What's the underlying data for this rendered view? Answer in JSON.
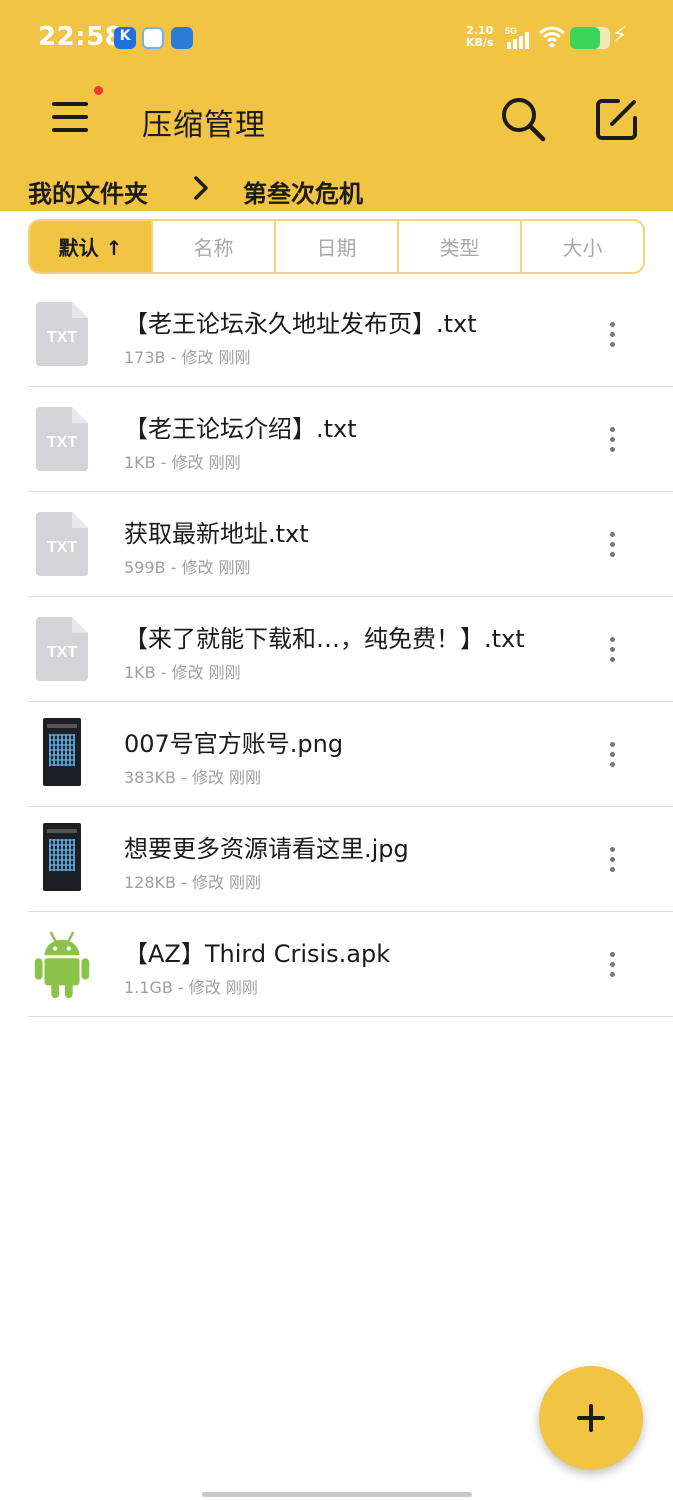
{
  "status_bar": {
    "time": "22:58",
    "net_speed_value": "2.10",
    "net_speed_unit": "KB/s",
    "network": "5G",
    "battery_level": 0.75
  },
  "app_bar": {
    "title": "压缩管理",
    "menu_icon": "menu-icon",
    "search_icon": "search-icon",
    "edit_icon": "edit-icon"
  },
  "breadcrumb": {
    "parent": "我的文件夹",
    "current": "第叁次危机"
  },
  "sort_tabs": [
    {
      "label": "默认 ↑",
      "active": true
    },
    {
      "label": "名称",
      "active": false
    },
    {
      "label": "日期",
      "active": false
    },
    {
      "label": "类型",
      "active": false
    },
    {
      "label": "大小",
      "active": false
    }
  ],
  "files": [
    {
      "name": "【老王论坛永久地址发布页】.txt",
      "meta": "173B - 修改 刚刚",
      "icon": "txt-file-icon",
      "icon_label": "TXT"
    },
    {
      "name": "【老王论坛介绍】.txt",
      "meta": "1KB - 修改 刚刚",
      "icon": "txt-file-icon",
      "icon_label": "TXT"
    },
    {
      "name": "获取最新地址.txt",
      "meta": "599B - 修改 刚刚",
      "icon": "txt-file-icon",
      "icon_label": "TXT"
    },
    {
      "name": "【来了就能下载和…，纯免费！】.txt",
      "meta": "1KB - 修改 刚刚",
      "icon": "txt-file-icon",
      "icon_label": "TXT"
    },
    {
      "name": "007号官方账号.png",
      "meta": "383KB - 修改 刚刚",
      "icon": "image-thumbnail-icon"
    },
    {
      "name": "想要更多资源请看这里.jpg",
      "meta": "128KB - 修改 刚刚",
      "icon": "image-thumbnail-icon"
    },
    {
      "name": "【AZ】Third Crisis.apk",
      "meta": "1.1GB - 修改 刚刚",
      "icon": "android-apk-icon"
    }
  ],
  "colors": {
    "accent": "#f2c443",
    "android_green": "#8bc34a",
    "txt_icon_gray": "#d3d3d8"
  },
  "fab_icon": "plus-icon"
}
